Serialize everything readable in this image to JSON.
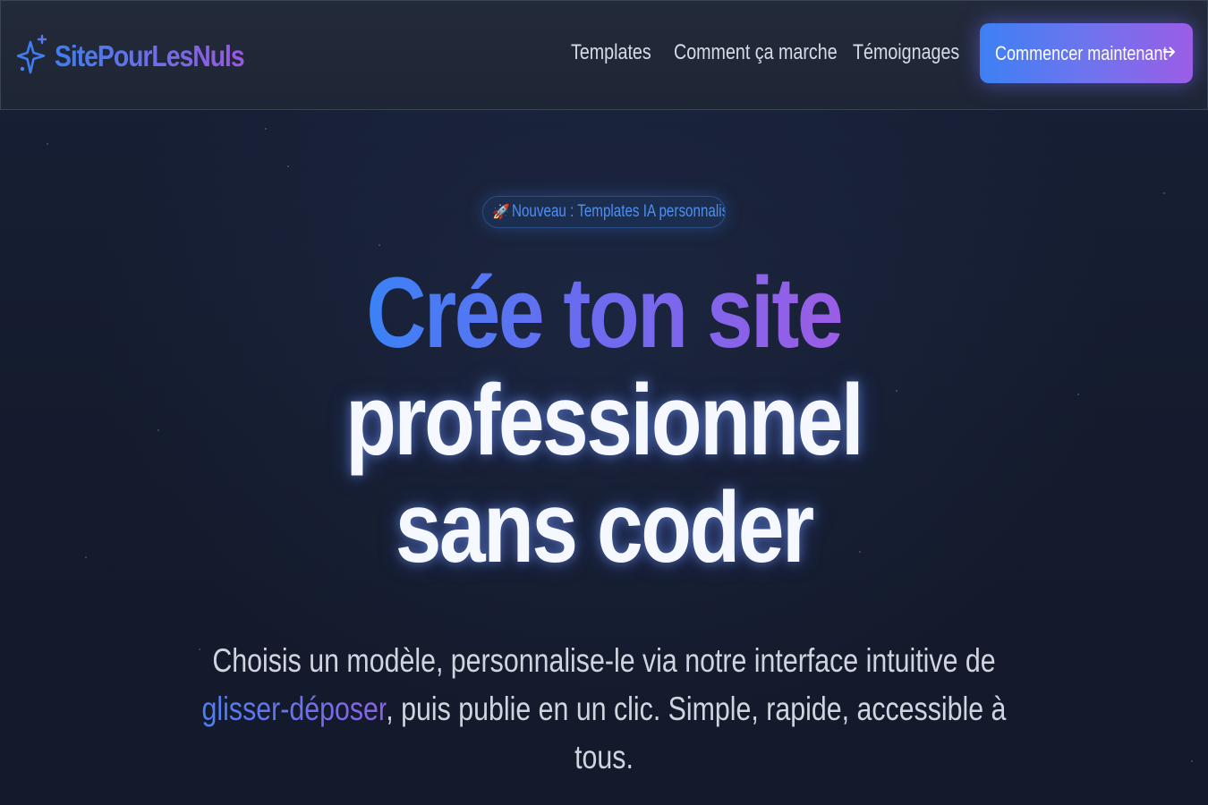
{
  "brand": {
    "name": "SitePourLesNuls",
    "icon": "sparkle-icon"
  },
  "nav": {
    "links": [
      {
        "label": "Templates"
      },
      {
        "label": "Comment ça marche"
      },
      {
        "label": "Témoignages"
      }
    ],
    "cta_label": "Commencer maintenant",
    "cta_icon": "arrow-right-icon"
  },
  "hero": {
    "badge": {
      "icon": "rocket-icon",
      "text": "Nouveau : Templates IA personnalisés"
    },
    "headline": {
      "line1_a": "Crée ton site",
      "line2": "professionnel",
      "line3": "sans coder"
    },
    "subtext": {
      "part1": "Choisis un modèle, personnalise-le via notre interface intuitive de ",
      "highlight": "glisser-déposer",
      "part2": ", puis publie en un clic. Simple, rapide, accessible à tous."
    }
  },
  "colors": {
    "background": "#141b2e",
    "accent_blue": "#3b82f6",
    "accent_purple": "#9b5de5",
    "nav_text": "#d7dbe6",
    "badge_text": "#4e8ff0"
  }
}
